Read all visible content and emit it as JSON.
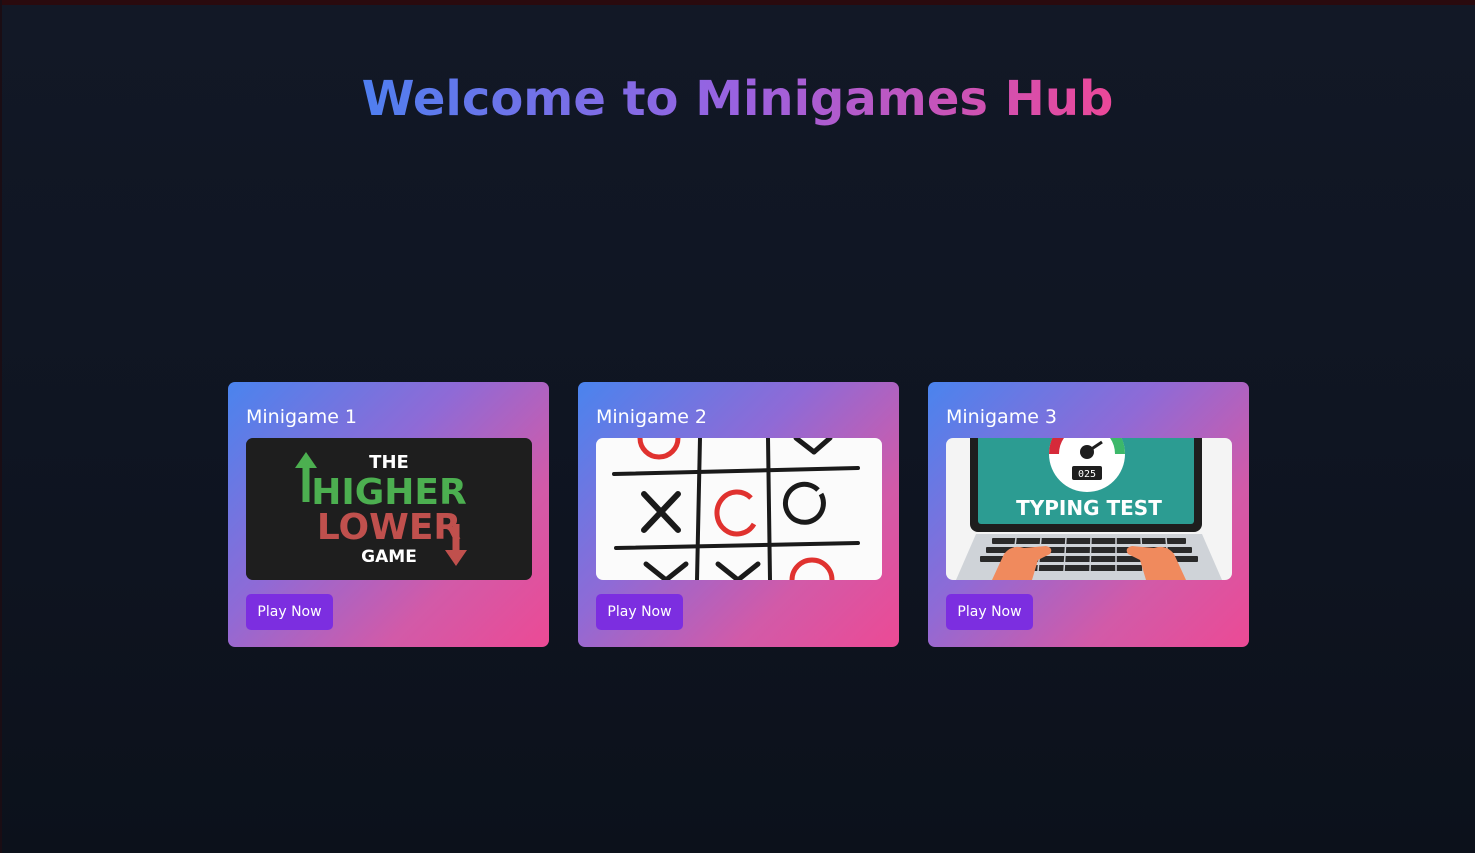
{
  "header": {
    "title": "Welcome to Minigames Hub"
  },
  "cards": [
    {
      "title": "Minigame 1",
      "button_label": "Play Now",
      "thumbnail": {
        "line1": "THE",
        "line2": "HIGHER",
        "line3": "LOWER",
        "line4": "GAME"
      }
    },
    {
      "title": "Minigame 2",
      "button_label": "Play Now"
    },
    {
      "title": "Minigame 3",
      "button_label": "Play Now",
      "thumbnail": {
        "caption": "TYPING TEST",
        "counter": "025"
      }
    }
  ],
  "colors": {
    "background": "#111726",
    "title_gradient_start": "#4f7ff0",
    "title_gradient_mid": "#9a62e0",
    "title_gradient_end": "#ec4899",
    "card_gradient_start": "#4a84ee",
    "card_gradient_end": "#ec4a95",
    "button": "#7c2ee0",
    "higher_green": "#4caf50",
    "lower_red": "#c0504d",
    "screen_teal": "#2c9c92"
  }
}
